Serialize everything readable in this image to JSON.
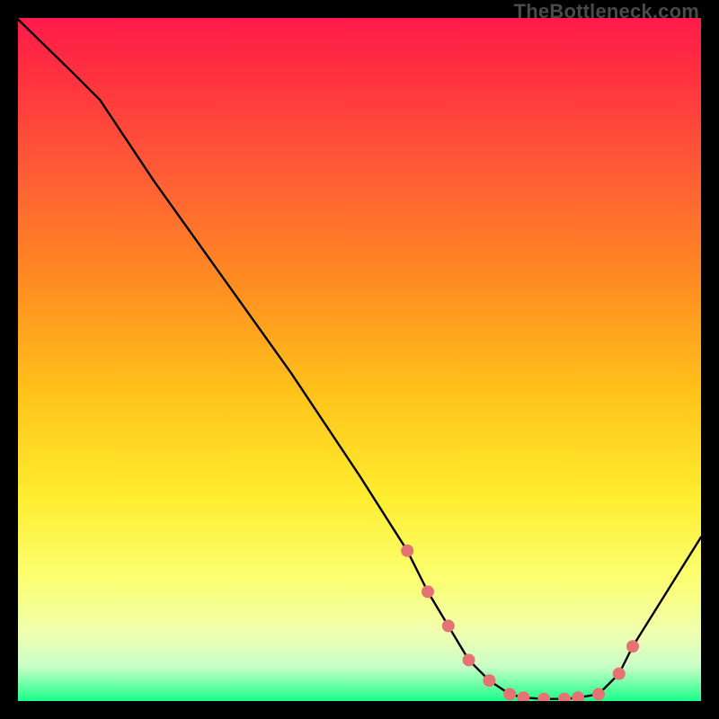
{
  "watermark": "TheBottleneck.com",
  "colors": {
    "bg": "#000000",
    "line": "#000000",
    "marker_fill": "#e57373",
    "marker_stroke": "#e57373",
    "gradient_top": "#ff1a4a",
    "gradient_bottom": "#19ff88"
  },
  "chart_data": {
    "type": "line",
    "title": "",
    "xlabel": "",
    "ylabel": "",
    "xlim": [
      0,
      100
    ],
    "ylim": [
      0,
      100
    ],
    "series": [
      {
        "name": "curve",
        "x": [
          0,
          8,
          12,
          20,
          30,
          40,
          50,
          57,
          60,
          63,
          66,
          69,
          72,
          74,
          77,
          80,
          82,
          85,
          88,
          90,
          100
        ],
        "y": [
          99.8,
          92,
          88,
          76,
          62,
          48,
          33,
          22,
          16,
          11,
          6,
          3,
          1,
          0.5,
          0.3,
          0.3,
          0.5,
          1,
          4,
          8,
          24
        ]
      }
    ],
    "markers": {
      "name": "highlighted-points",
      "x": [
        57,
        60,
        63,
        66,
        69,
        72,
        74,
        77,
        80,
        82,
        85,
        88,
        90
      ],
      "y": [
        22,
        16,
        11,
        6,
        3,
        1,
        0.5,
        0.3,
        0.3,
        0.5,
        1,
        4,
        8
      ]
    }
  }
}
